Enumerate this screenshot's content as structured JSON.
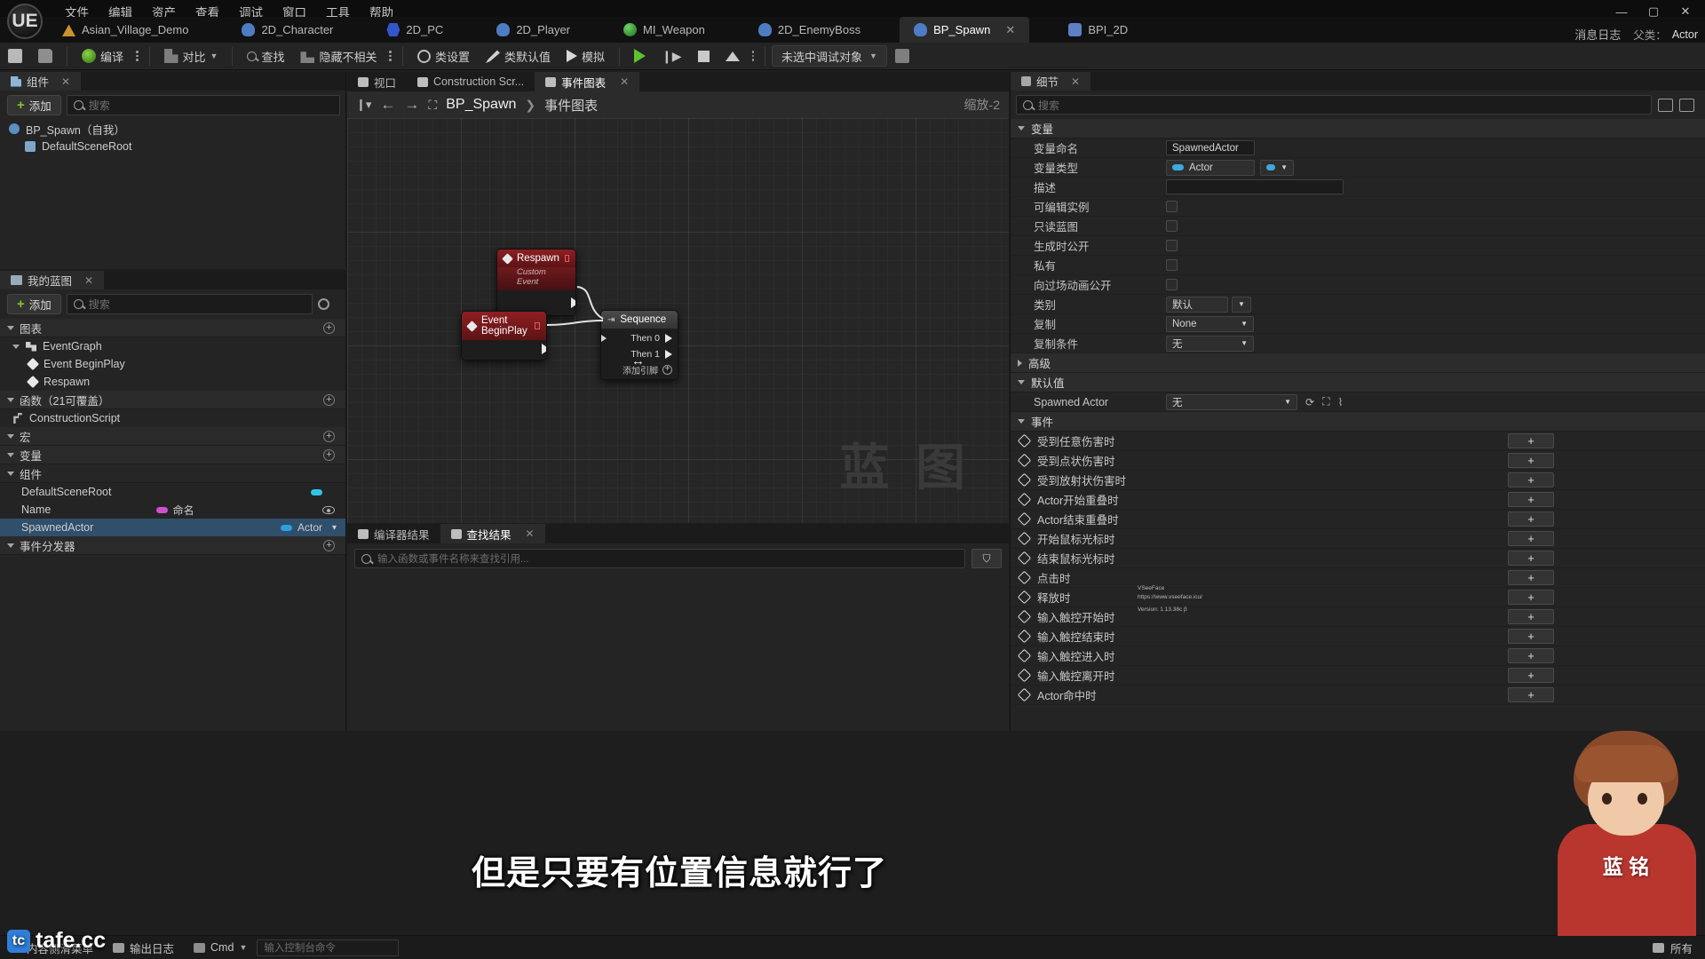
{
  "menu": {
    "items": [
      "文件",
      "编辑",
      "资产",
      "查看",
      "调试",
      "窗口",
      "工具",
      "帮助"
    ],
    "logo": "UE"
  },
  "window_controls": {
    "minimize": "—",
    "maximize": "▢",
    "close": "✕"
  },
  "asset_tabs": [
    {
      "label": "Asian_Village_Demo",
      "icon": "mountain-icon",
      "active": false
    },
    {
      "label": "2D_Character",
      "icon": "person-icon",
      "active": false
    },
    {
      "label": "2D_PC",
      "icon": "network-icon",
      "active": false
    },
    {
      "label": "2D_Player",
      "icon": "person-icon",
      "active": false
    },
    {
      "label": "MI_Weapon",
      "icon": "sphere-icon",
      "active": false
    },
    {
      "label": "2D_EnemyBoss",
      "icon": "person-icon",
      "active": false
    },
    {
      "label": "BP_Spawn",
      "icon": "person-icon",
      "active": true,
      "close": "✕"
    },
    {
      "label": "BPI_2D",
      "icon": "interface-icon",
      "active": false
    }
  ],
  "message_log": {
    "label": "消息日志",
    "icon": "log-icon"
  },
  "parent_class": {
    "label": "父类：",
    "value": "Actor"
  },
  "toolbar": {
    "save_label": "",
    "compile_label": "编译",
    "diff_label": "对比",
    "find_label": "查找",
    "hide_unrelated_label": "隐藏不相关",
    "class_settings_label": "类设置",
    "class_defaults_label": "类默认值",
    "simulate_label": "模拟",
    "debug_target": "未选中调试对象"
  },
  "components_panel": {
    "tab_title": "组件",
    "tab_close": "✕",
    "add_label": "添加",
    "search_placeholder": "搜索",
    "tree": [
      {
        "label": "BP_Spawn（自我）",
        "indent": 0
      },
      {
        "label": "DefaultSceneRoot",
        "indent": 1
      }
    ]
  },
  "myblueprint_panel": {
    "tab_title": "我的蓝图",
    "tab_close": "✕",
    "add_label": "添加",
    "search_placeholder": "搜索",
    "sections": [
      {
        "title": "图表",
        "items": [
          {
            "label": "EventGraph",
            "type": "graph",
            "indent": 0
          },
          {
            "label": "Event BeginPlay",
            "type": "event",
            "indent": 1
          },
          {
            "label": "Respawn",
            "type": "event",
            "indent": 1
          }
        ]
      },
      {
        "title": "函数（21可覆盖）",
        "items": [
          {
            "label": "ConstructionScript",
            "type": "function",
            "indent": 0
          }
        ]
      },
      {
        "title": "宏",
        "items": []
      },
      {
        "title": "变量",
        "items": []
      }
    ],
    "components_group": "组件",
    "variables": [
      {
        "name": "DefaultSceneRoot",
        "type": "",
        "pill_color": "#2ec5e8",
        "selected": false
      },
      {
        "name": "Name",
        "type": "命名",
        "pill_color": "#d04fd0",
        "selected": false,
        "has_eye": true
      },
      {
        "name": "SpawnedActor",
        "type": "Actor",
        "pill_color": "#2f9de0",
        "selected": true
      }
    ],
    "event_dispatcher": "事件分发器"
  },
  "graph": {
    "tabs": [
      {
        "label": "视口",
        "icon": "viewport-icon",
        "active": false
      },
      {
        "label": "Construction Scr...",
        "icon": "function-icon",
        "active": false
      },
      {
        "label": "事件图表",
        "icon": "graph-icon",
        "active": true,
        "close": "✕"
      }
    ],
    "breadcrumb_root": "BP_Spawn",
    "breadcrumb_sep": "❯",
    "breadcrumb_leaf": "事件图表",
    "zoom_label": "缩放-2",
    "watermark": "蓝 图",
    "nodes": [
      {
        "id": "respawn",
        "title": "Respawn",
        "subtitle": "Custom Event",
        "kind": "event-red"
      },
      {
        "id": "beginplay",
        "title": "Event BeginPlay",
        "subtitle": "",
        "kind": "event-red"
      },
      {
        "id": "sequence",
        "title": "Sequence",
        "kind": "flow-grey",
        "pins": [
          "Then 0",
          "Then 1"
        ],
        "add_pin_label": "添加引脚"
      }
    ]
  },
  "results_panel": {
    "tabs": [
      {
        "label": "编译器结果",
        "icon": "compiler-icon",
        "active": false
      },
      {
        "label": "查找结果",
        "icon": "search-icon",
        "active": true,
        "close": "✕"
      }
    ],
    "search_placeholder": "输入函数或事件名称来查找引用...",
    "filter_button": "⛉"
  },
  "details_panel": {
    "tab_title": "细节",
    "tab_close": "✕",
    "search_placeholder": "搜索",
    "sections": {
      "variable": {
        "title": "变量",
        "rows": [
          {
            "label": "变量命名",
            "kind": "text",
            "value": "SpawnedActor"
          },
          {
            "label": "变量类型",
            "kind": "type",
            "value": "Actor"
          },
          {
            "label": "描述",
            "kind": "text",
            "value": ""
          },
          {
            "label": "可编辑实例",
            "kind": "checkbox",
            "value": false
          },
          {
            "label": "只读蓝图",
            "kind": "checkbox",
            "value": false
          },
          {
            "label": "生成时公开",
            "kind": "checkbox",
            "value": false
          },
          {
            "label": "私有",
            "kind": "checkbox",
            "value": false
          },
          {
            "label": "向过场动画公开",
            "kind": "checkbox",
            "value": false
          },
          {
            "label": "类别",
            "kind": "combo",
            "value": "默认"
          },
          {
            "label": "复制",
            "kind": "combo-wide",
            "value": "None"
          },
          {
            "label": "复制条件",
            "kind": "combo-wide",
            "value": "无"
          }
        ]
      },
      "advanced": {
        "title": "高级"
      },
      "defaults": {
        "title": "默认值",
        "rows": [
          {
            "label": "Spawned Actor",
            "kind": "asset",
            "value": "无"
          }
        ]
      },
      "events": {
        "title": "事件",
        "add_label": "+",
        "rows": [
          "受到任意伤害时",
          "受到点状伤害时",
          "受到放射状伤害时",
          "Actor开始重叠时",
          "Actor结束重叠时",
          "开始鼠标光标时",
          "结束鼠标光标时",
          "点击时",
          "释放时",
          "输入触控开始时",
          "输入触控结束时",
          "输入触控进入时",
          "输入触控离开时",
          "Actor命中时"
        ]
      }
    }
  },
  "statusbar": {
    "content_drawer": "内容侧滑菜单",
    "output_log": "输出日志",
    "cmd_label": "Cmd",
    "cmd_placeholder": "输入控制台命令",
    "all_saved": "所有"
  },
  "overlays": {
    "subtitle": "但是只要有位置信息就行了",
    "brand": "tafe.cc",
    "vface_line1": "VSeeFace",
    "vface_line2": "https://www.vseeface.icu/",
    "vface_line3": "Version: 1.13.38c β",
    "avatar_logo": "蓝 铭"
  },
  "colors": {
    "accent_blue": "#2f9de0",
    "compile_green": "#5cc22c",
    "event_red": "#8e1f22",
    "selection": "#2f4f6b"
  }
}
